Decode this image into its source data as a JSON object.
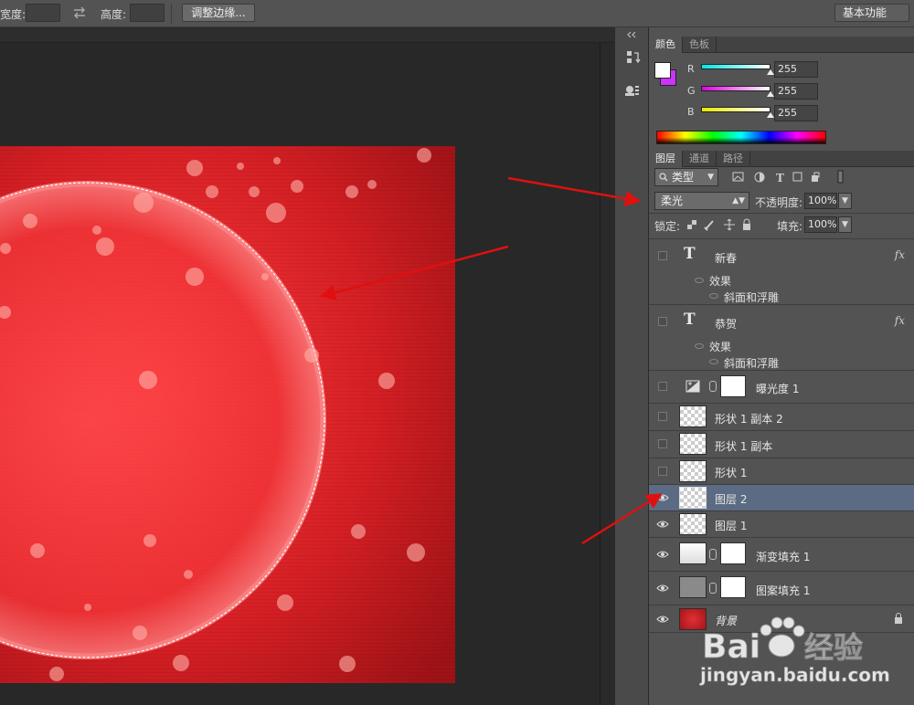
{
  "options_bar": {
    "width_label": "宽度:",
    "height_label": "高度:",
    "refine_edge_button": "调整边缘...",
    "workspace": "基本功能"
  },
  "color_panel": {
    "tabs": [
      "颜色",
      "色板"
    ],
    "active_tab": 0,
    "channels": [
      {
        "label": "R",
        "value": "255",
        "color": "#00e5e5"
      },
      {
        "label": "G",
        "value": "255",
        "color": "#e000e0"
      },
      {
        "label": "B",
        "value": "255",
        "color": "#e8e800"
      }
    ],
    "foreground_color": "#ffffff",
    "background_color": "#cc33ff"
  },
  "layers_panel": {
    "tabs": [
      "图层",
      "通道",
      "路径"
    ],
    "active_tab": 0,
    "filter_kind": "类型",
    "blend_mode": "柔光",
    "opacity_label": "不透明度:",
    "opacity_value": "100%",
    "lock_label": "锁定:",
    "fill_label": "填充:",
    "fill_value": "100%",
    "layers": [
      {
        "name": "新春",
        "type": "text",
        "visible": false,
        "fx": "fx",
        "effects_label": "效果",
        "effect": "斜面和浮雕"
      },
      {
        "name": "恭贺",
        "type": "text",
        "visible": false,
        "fx": "fx",
        "effects_label": "效果",
        "effect": "斜面和浮雕"
      },
      {
        "name": "曝光度 1",
        "type": "adjustment",
        "visible": false
      },
      {
        "name": "形状 1 副本 2",
        "type": "shape",
        "visible": false
      },
      {
        "name": "形状 1 副本",
        "type": "shape",
        "visible": false
      },
      {
        "name": "形状 1",
        "type": "shape",
        "visible": false
      },
      {
        "name": "图层 2",
        "type": "pixel",
        "visible": true,
        "selected": true
      },
      {
        "name": "图层 1",
        "type": "pixel",
        "visible": true
      },
      {
        "name": "渐变填充 1",
        "type": "gradient-fill",
        "visible": true
      },
      {
        "name": "图案填充 1",
        "type": "pattern-fill",
        "visible": true
      },
      {
        "name": "背景",
        "type": "background",
        "visible": true,
        "locked": true
      }
    ]
  },
  "watermark": {
    "brand_left": "Bai",
    "brand_right": "经验",
    "url": "jingyan.baidu.com"
  }
}
